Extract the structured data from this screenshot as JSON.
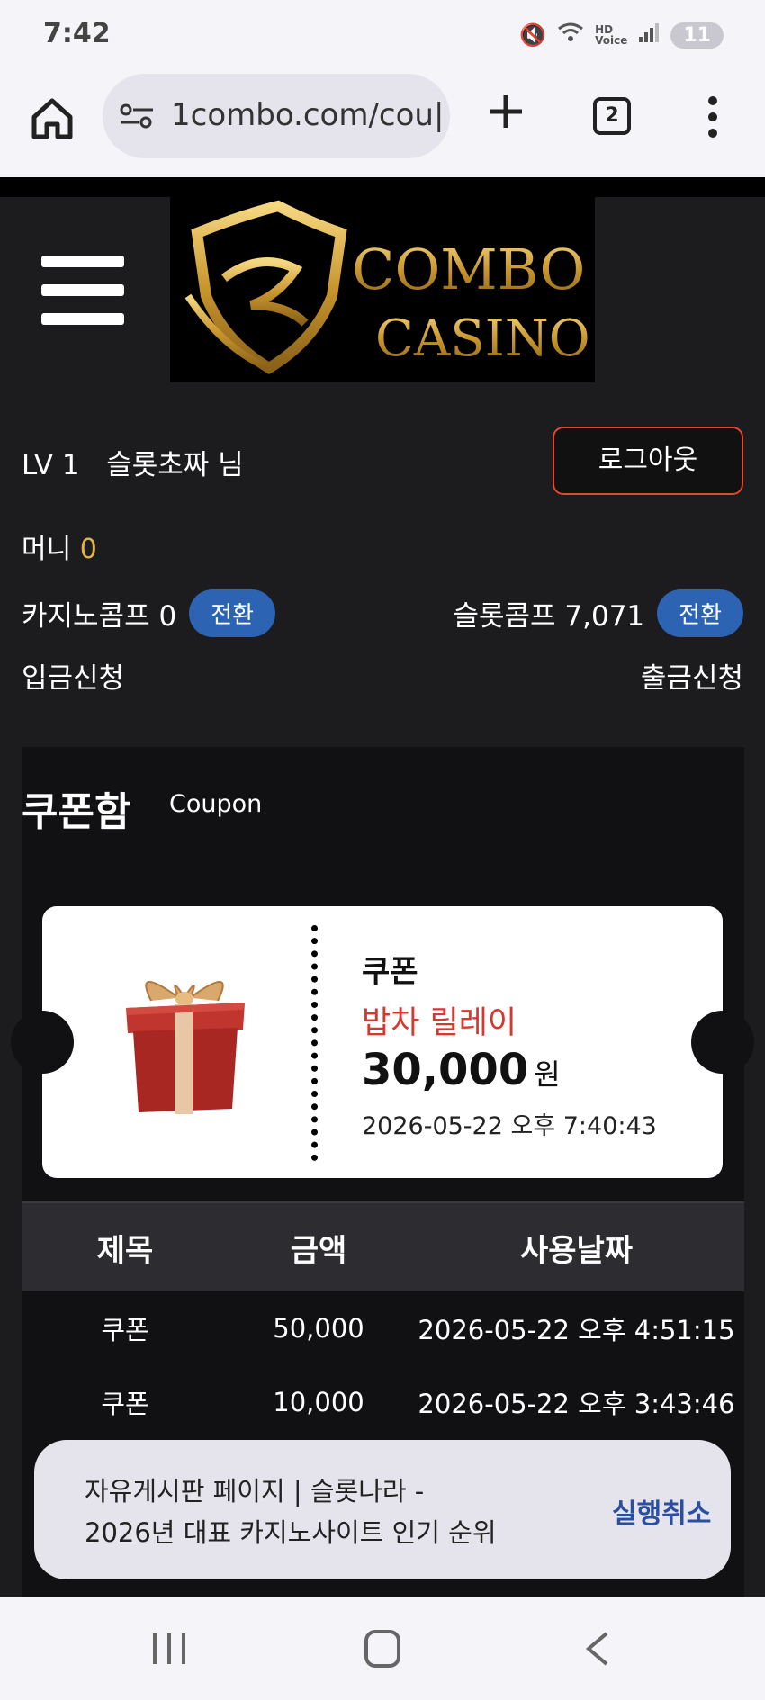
{
  "status": {
    "time": "7:42",
    "battery": "11"
  },
  "browser": {
    "url": "1combo.com/cou|",
    "tab_count": "2"
  },
  "user": {
    "level": "LV 1",
    "name": "슬롯초짜 님",
    "logout_label": "로그아웃",
    "money_label": "머니",
    "money_value": "0",
    "casino_comp_label": "카지노콤프",
    "casino_comp_value": "0",
    "slot_comp_label": "슬롯콤프",
    "slot_comp_value": "7,071",
    "switch_label": "전환",
    "deposit_label": "입금신청",
    "withdraw_label": "출금신청"
  },
  "coupon": {
    "title": "쿠폰함",
    "subtitle": "Coupon",
    "ticket": {
      "label": "쿠폰",
      "name": "밥차 릴레이",
      "amount": "30,000",
      "unit": "원",
      "date": "2026-05-22 오후 7:40:43"
    },
    "table": {
      "headers": [
        "제목",
        "금액",
        "사용날짜"
      ],
      "rows": [
        [
          "쿠폰",
          "50,000",
          "2026-05-22 오후 4:51:15"
        ],
        [
          "쿠폰",
          "10,000",
          "2026-05-22 오후 3:43:46"
        ]
      ]
    }
  },
  "toast": {
    "line1": "자유게시판 페이지 | 슬롯나라 -",
    "line2": "2026년 대표 카지노사이트 인기 순위",
    "action": "실행취소"
  },
  "logo": {
    "text_line1": "COMBO",
    "text_line2": "CASINO"
  },
  "colors": {
    "accent_gold": "#e3b341",
    "logout_border": "#e0492c",
    "switch_blue": "#2c64b3",
    "coupon_red": "#d4392f"
  }
}
